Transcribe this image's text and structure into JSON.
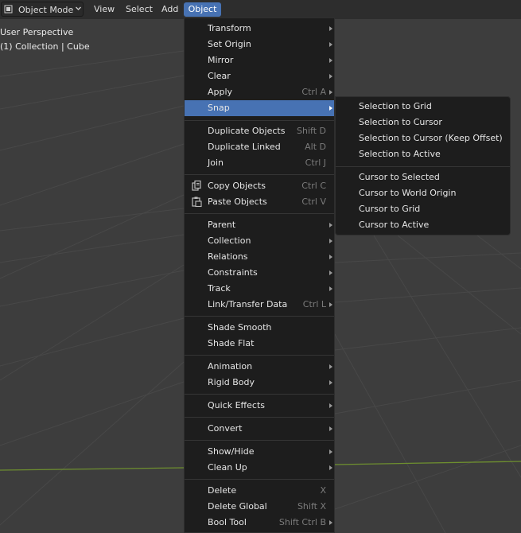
{
  "header": {
    "mode_label": "Object Mode",
    "menus": [
      "View",
      "Select",
      "Add",
      "Object"
    ],
    "active_menu": "Object"
  },
  "viewport": {
    "perspective_label": "User Perspective",
    "collection_label": "(1) Collection | Cube"
  },
  "object_menu": {
    "items": [
      {
        "label": "Transform",
        "shortcut": "",
        "submenu": true
      },
      {
        "label": "Set Origin",
        "shortcut": "",
        "submenu": true
      },
      {
        "label": "Mirror",
        "shortcut": "",
        "submenu": true
      },
      {
        "label": "Clear",
        "shortcut": "",
        "submenu": true
      },
      {
        "label": "Apply",
        "shortcut": "Ctrl A",
        "submenu": true
      },
      {
        "label": "Snap",
        "shortcut": "",
        "submenu": true,
        "highlighted": true
      },
      {
        "label": "Duplicate Objects",
        "shortcut": "Shift D",
        "submenu": false
      },
      {
        "label": "Duplicate Linked",
        "shortcut": "Alt D",
        "submenu": false
      },
      {
        "label": "Join",
        "shortcut": "Ctrl J",
        "submenu": false
      },
      {
        "label": "Copy Objects",
        "shortcut": "Ctrl C",
        "submenu": false,
        "icon": "copy-icon"
      },
      {
        "label": "Paste Objects",
        "shortcut": "Ctrl V",
        "submenu": false,
        "icon": "paste-icon"
      },
      {
        "label": "Parent",
        "shortcut": "",
        "submenu": true
      },
      {
        "label": "Collection",
        "shortcut": "",
        "submenu": true
      },
      {
        "label": "Relations",
        "shortcut": "",
        "submenu": true
      },
      {
        "label": "Constraints",
        "shortcut": "",
        "submenu": true
      },
      {
        "label": "Track",
        "shortcut": "",
        "submenu": true
      },
      {
        "label": "Link/Transfer Data",
        "shortcut": "Ctrl L",
        "submenu": true
      },
      {
        "label": "Shade Smooth",
        "shortcut": "",
        "submenu": false
      },
      {
        "label": "Shade Flat",
        "shortcut": "",
        "submenu": false
      },
      {
        "label": "Animation",
        "shortcut": "",
        "submenu": true
      },
      {
        "label": "Rigid Body",
        "shortcut": "",
        "submenu": true
      },
      {
        "label": "Quick Effects",
        "shortcut": "",
        "submenu": true
      },
      {
        "label": "Convert",
        "shortcut": "",
        "submenu": true
      },
      {
        "label": "Show/Hide",
        "shortcut": "",
        "submenu": true
      },
      {
        "label": "Clean Up",
        "shortcut": "",
        "submenu": true
      },
      {
        "label": "Delete",
        "shortcut": "X",
        "submenu": false
      },
      {
        "label": "Delete Global",
        "shortcut": "Shift X",
        "submenu": false
      },
      {
        "label": "Bool Tool",
        "shortcut": "Shift Ctrl B",
        "submenu": true
      }
    ]
  },
  "snap_submenu": {
    "items": [
      {
        "label": "Selection to Grid"
      },
      {
        "label": "Selection to Cursor"
      },
      {
        "label": "Selection to Cursor (Keep Offset)"
      },
      {
        "label": "Selection to Active"
      },
      {
        "label": "Cursor to Selected"
      },
      {
        "label": "Cursor to World Origin"
      },
      {
        "label": "Cursor to Grid"
      },
      {
        "label": "Cursor to Active"
      }
    ]
  },
  "colors": {
    "accent": "#4772b3",
    "viewport_bg": "#3d3d3d",
    "grid_line": "#4a4a4a",
    "x_axis": "#7a9a34",
    "menu_bg": "#1d1d1d"
  }
}
